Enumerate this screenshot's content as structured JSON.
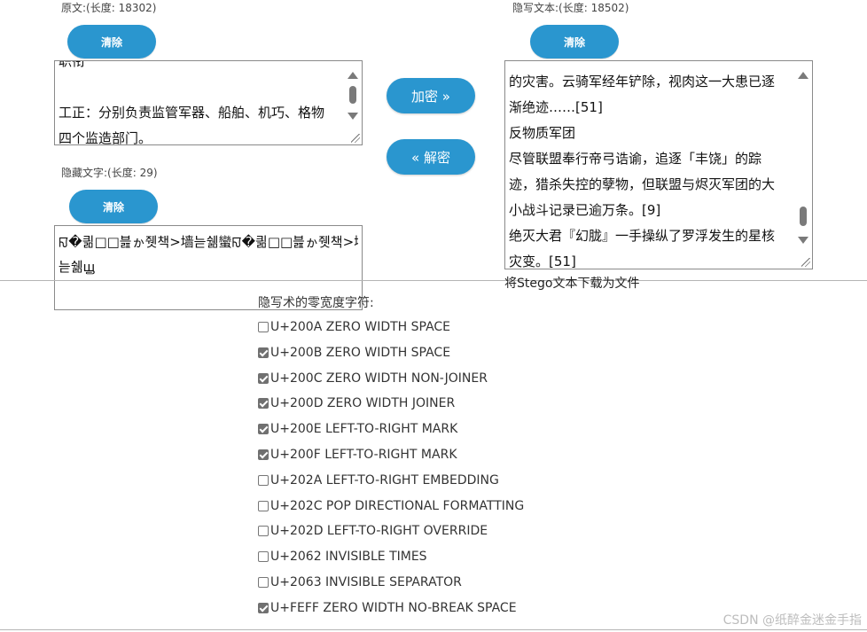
{
  "original": {
    "label": "原文:(长度: 18302)",
    "clear_label": "清除",
    "lines": [
      "职衔",
      "",
      "工正：分别负责监管军器、船舶、机巧、格物",
      "四个监造部门。"
    ]
  },
  "hidden": {
    "label": "隐藏文字:(长度: 29)",
    "clear_label": "清除",
    "lines": [
      "ꡍ�킒□□븚ゕ쥇책>墙늗쉚蠻ꡍ�킒□□븚ゕ쥇책>墙",
      "늗쉚ꚗ"
    ]
  },
  "actions": {
    "encrypt_label": "加密 »",
    "decrypt_label": "« 解密"
  },
  "stego": {
    "label": "隐写文本:(长度: 18502)",
    "clear_label": "清除",
    "lines": [
      "的灾害。云骑军经年铲除，视肉这一大患已逐",
      "渐绝迹……[51]",
      "反物质军团",
      "尽管联盟奉行帝弓诰谕，追逐「丰饶」的踪",
      "迹，猎杀失控的孽物，但联盟与烬灭军团的大",
      "小战斗记录已逾万条。[9]",
      "绝灭大君『幻胧』一手操纵了罗浮发生的星核",
      "灾变。[51]"
    ],
    "download_label": "将Stego文本下载为文件"
  },
  "chars": {
    "heading": "隐写术的零宽度字符:",
    "items": [
      {
        "label": "U+200A ZERO WIDTH SPACE",
        "checked": false
      },
      {
        "label": "U+200B ZERO WIDTH SPACE",
        "checked": true
      },
      {
        "label": "U+200C ZERO WIDTH NON-JOINER",
        "checked": true
      },
      {
        "label": "U+200D ZERO WIDTH JOINER",
        "checked": true
      },
      {
        "label": "U+200E LEFT-TO-RIGHT MARK",
        "checked": true
      },
      {
        "label": "U+200F LEFT-TO-RIGHT MARK",
        "checked": true
      },
      {
        "label": "U+202A LEFT-TO-RIGHT EMBEDDING",
        "checked": false
      },
      {
        "label": "U+202C POP DIRECTIONAL FORMATTING",
        "checked": false
      },
      {
        "label": "U+202D LEFT-TO-RIGHT OVERRIDE",
        "checked": false
      },
      {
        "label": "U+2062 INVISIBLE TIMES",
        "checked": false
      },
      {
        "label": "U+2063 INVISIBLE SEPARATOR",
        "checked": false
      },
      {
        "label": "U+FEFF ZERO WIDTH NO-BREAK SPACE",
        "checked": true
      }
    ]
  },
  "watermark": "CSDN @纸醉金迷金手指"
}
